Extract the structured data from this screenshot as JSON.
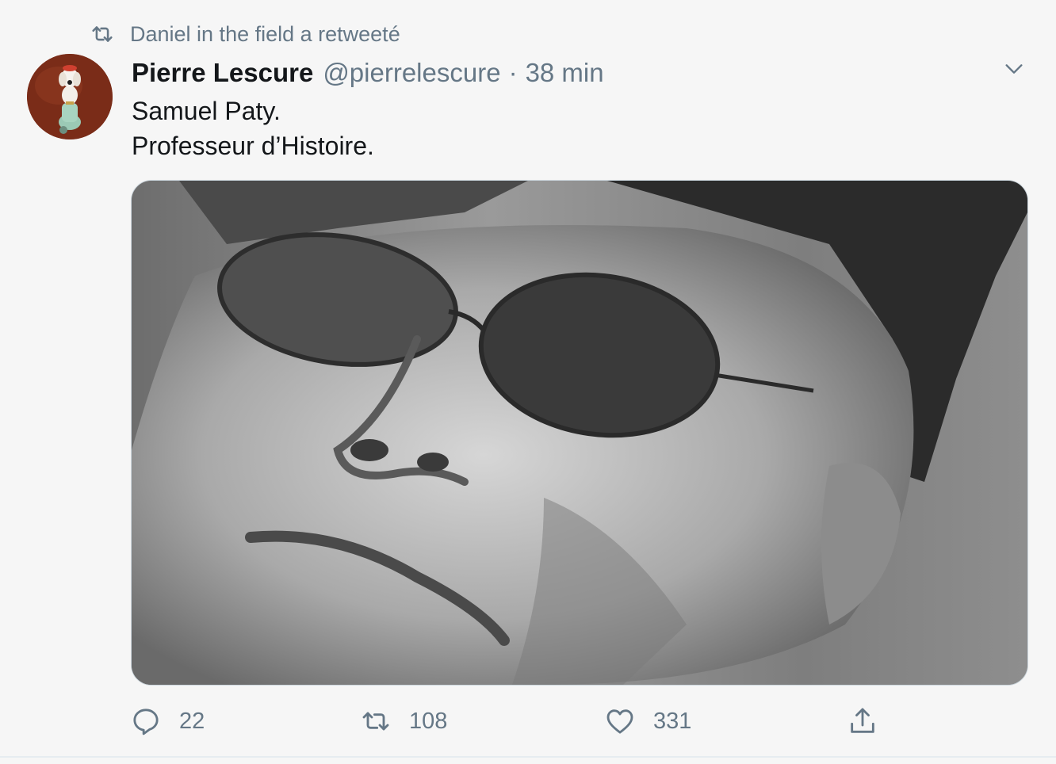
{
  "retweet_context": {
    "icon": "retweet-icon",
    "text": "Daniel in the field a retweeté"
  },
  "tweet": {
    "author": {
      "display_name": "Pierre Lescure",
      "handle": "@pierrelescure",
      "avatar": "avatar-figurine"
    },
    "separator": "·",
    "time": "38 min",
    "lines": [
      "Samuel Paty.",
      "Professeur d’Histoire."
    ],
    "media": {
      "kind": "photo",
      "description_icon": "portrait-photo"
    },
    "menu_icon": "chevron-down-icon"
  },
  "actions": {
    "reply": {
      "icon": "reply-icon",
      "count": "22"
    },
    "retweet": {
      "icon": "retweet-icon",
      "count": "108"
    },
    "like": {
      "icon": "heart-icon",
      "count": "331"
    },
    "share": {
      "icon": "share-icon"
    }
  },
  "colors": {
    "text_primary": "#14171a",
    "text_secondary": "#657786",
    "background": "#f6f6f6",
    "border": "#ccd6dd"
  }
}
